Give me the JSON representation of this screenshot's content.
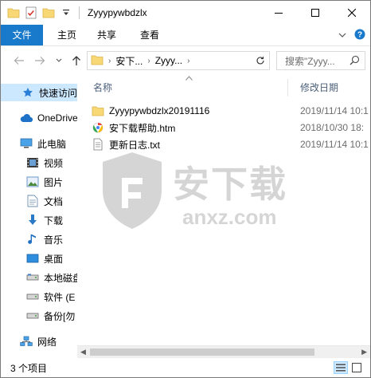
{
  "window": {
    "title": "Zyyypywbdzlx",
    "accent_color": "#1979ca"
  },
  "ribbon": {
    "tabs": [
      {
        "label": "文件"
      },
      {
        "label": "主页"
      },
      {
        "label": "共享"
      },
      {
        "label": "查看"
      }
    ]
  },
  "address": {
    "crumbs": [
      "安下...",
      "Zyyy..."
    ],
    "search_placeholder": "搜索\"Zyyy..."
  },
  "nav": {
    "items": [
      {
        "label": "快速访问",
        "icon": "star-icon",
        "selected": true
      },
      {
        "label": "OneDrive",
        "icon": "cloud-icon"
      },
      {
        "label": "此电脑",
        "icon": "computer-icon"
      },
      {
        "label": "视频",
        "icon": "video-icon"
      },
      {
        "label": "图片",
        "icon": "picture-icon"
      },
      {
        "label": "文档",
        "icon": "document-icon"
      },
      {
        "label": "下载",
        "icon": "download-icon"
      },
      {
        "label": "音乐",
        "icon": "music-icon"
      },
      {
        "label": "桌面",
        "icon": "desktop-icon"
      },
      {
        "label": "本地磁盘",
        "icon": "drive-icon"
      },
      {
        "label": "软件 (E",
        "icon": "drive-icon"
      },
      {
        "label": "备份[勿",
        "icon": "drive-icon"
      },
      {
        "label": "网络",
        "icon": "network-icon"
      }
    ]
  },
  "columns": {
    "name": "名称",
    "modified": "修改日期"
  },
  "files": [
    {
      "name": "Zyyypywbdzlx20191116",
      "date": "2019/11/14 10:1",
      "icon": "folder-icon"
    },
    {
      "name": "安下载帮助.htm",
      "date": "2018/10/30 18:",
      "icon": "html-file-icon"
    },
    {
      "name": "更新日志.txt",
      "date": "2019/11/14 10:1",
      "icon": "text-file-icon"
    }
  ],
  "watermark": {
    "text": "安下载",
    "url": "anxz.com"
  },
  "status": {
    "item_count": "3 个项目"
  }
}
